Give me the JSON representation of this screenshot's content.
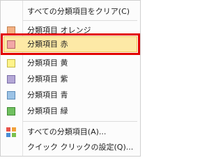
{
  "menu": {
    "clear_all": {
      "label": "すべての分類項目をクリア(C)"
    },
    "categories": [
      {
        "label": "分類項目 オレンジ",
        "swatch": "#f4b183",
        "border": "#c0804f"
      },
      {
        "label": "分類項目 赤",
        "swatch": "#f2a7a7",
        "border": "#b66a6a",
        "selected": true
      },
      {
        "label": "分類項目 黄",
        "swatch": "#fff38a",
        "border": "#c5b94a"
      },
      {
        "label": "分類項目 紫",
        "swatch": "#b4a7d6",
        "border": "#7a6da7"
      },
      {
        "label": "分類項目 青",
        "swatch": "#9cc3e6",
        "border": "#5e8cb8"
      },
      {
        "label": "分類項目 緑",
        "swatch": "#70c060",
        "border": "#3f8a33"
      }
    ],
    "all_categories": {
      "label": "すべての分類項目(A)...",
      "icon": "category-grid-icon",
      "icon_colors": [
        "#e8534a",
        "#f2a13a",
        "#4a8fd6",
        "#7cc04d"
      ]
    },
    "quick_click": {
      "label": "クイック クリックの設定(Q)..."
    },
    "highlight_color": "#e30000"
  }
}
